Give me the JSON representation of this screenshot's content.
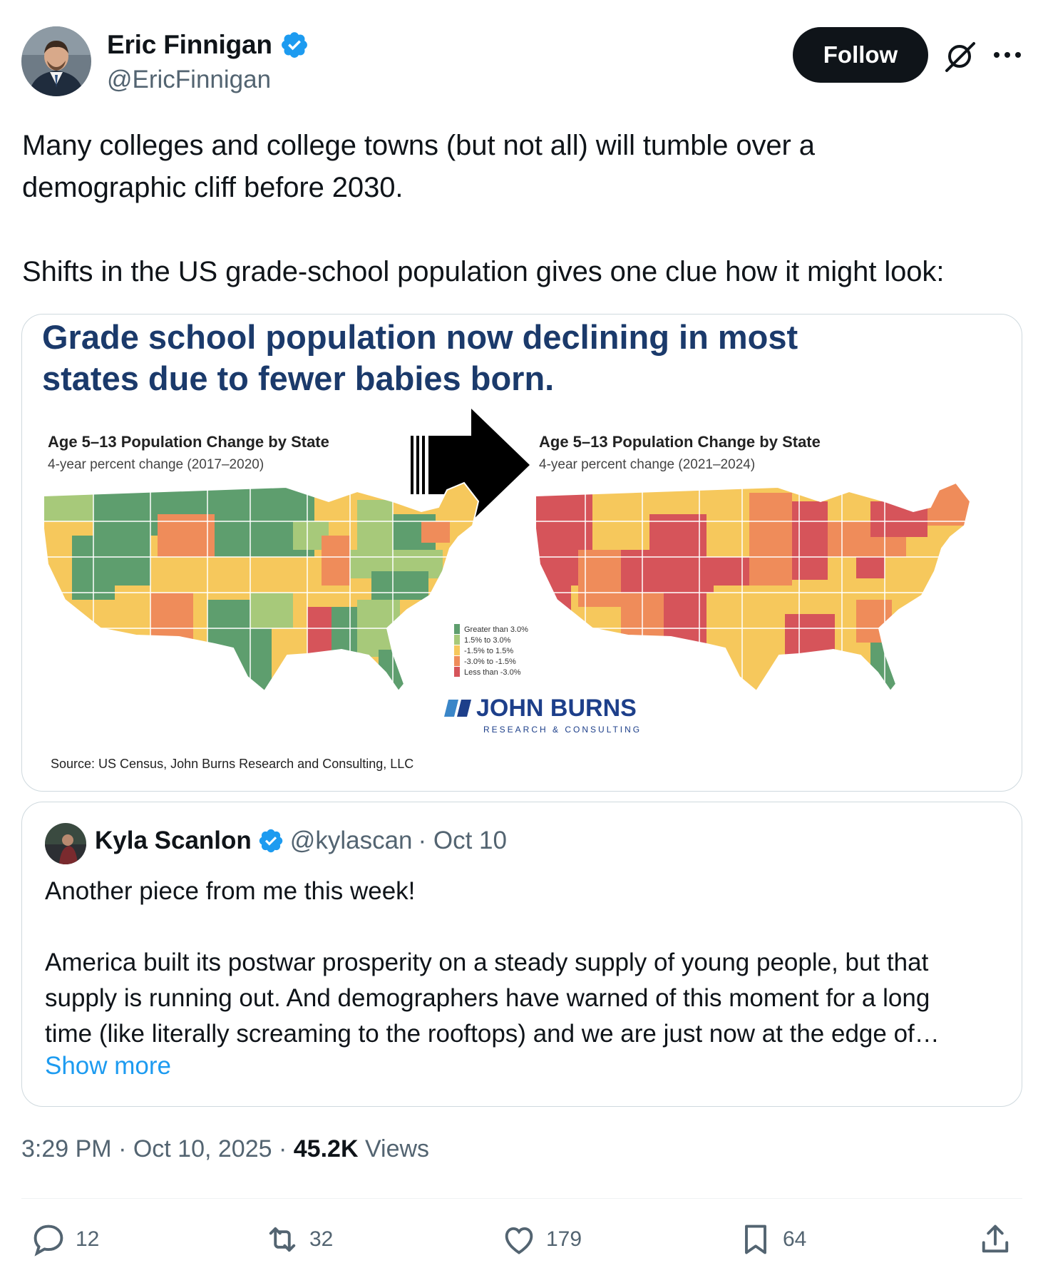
{
  "author": {
    "display_name": "Eric Finnigan",
    "handle": "@EricFinnigan",
    "verified": true
  },
  "follow_label": "Follow",
  "tweet_text": "Many colleges and college towns (but not all) will tumble over a\ndemographic cliff before 2030.\n\nShifts in the US grade-school population gives one clue how it might look:",
  "infographic": {
    "headline_line1": "Grade school population now declining in most",
    "headline_line2": "states due to fewer babies born.",
    "left_title": "Age 5–13 Population Change by State",
    "left_subtitle": "4-year percent change (2017–2020)",
    "right_title": "Age 5–13 Population Change by State",
    "right_subtitle": "4-year percent change (2021–2024)",
    "legend": [
      {
        "label": "Greater than 3.0%",
        "color": "#5e9e6e"
      },
      {
        "label": "1.5% to 3.0%",
        "color": "#a7c97a"
      },
      {
        "label": "-1.5% to 1.5%",
        "color": "#f6c85c"
      },
      {
        "label": "-3.0% to -1.5%",
        "color": "#ef8c5a"
      },
      {
        "label": "Less than -3.0%",
        "color": "#d6545a"
      }
    ],
    "brand_name": "JOHN BURNS",
    "brand_sub": "RESEARCH & CONSULTING",
    "source": "Source: US Census, John Burns Research and Consulting, LLC"
  },
  "quote": {
    "display_name": "Kyla Scanlon",
    "handle": "@kylascan",
    "date": "· Oct 10",
    "text": "Another piece from me this week!\n\nAmerica built its postwar prosperity on a steady supply of young people, but that\nsupply is running out. And demographers have warned of this moment for a long\ntime (like literally screaming to the rooftops) and we are just now at the edge of…",
    "show_more": "Show more"
  },
  "meta": {
    "time": "3:29 PM",
    "date": "· Oct 10, 2025 ·",
    "views_count": "45.2K",
    "views_label": "Views"
  },
  "actions": {
    "replies": "12",
    "reposts": "32",
    "likes": "179",
    "bookmarks": "64"
  },
  "colors": {
    "accent": "#1d9bf0",
    "text": "#0f1419",
    "muted": "#536471",
    "headline": "#1b3a6b",
    "brand": "#1d3f8a"
  }
}
